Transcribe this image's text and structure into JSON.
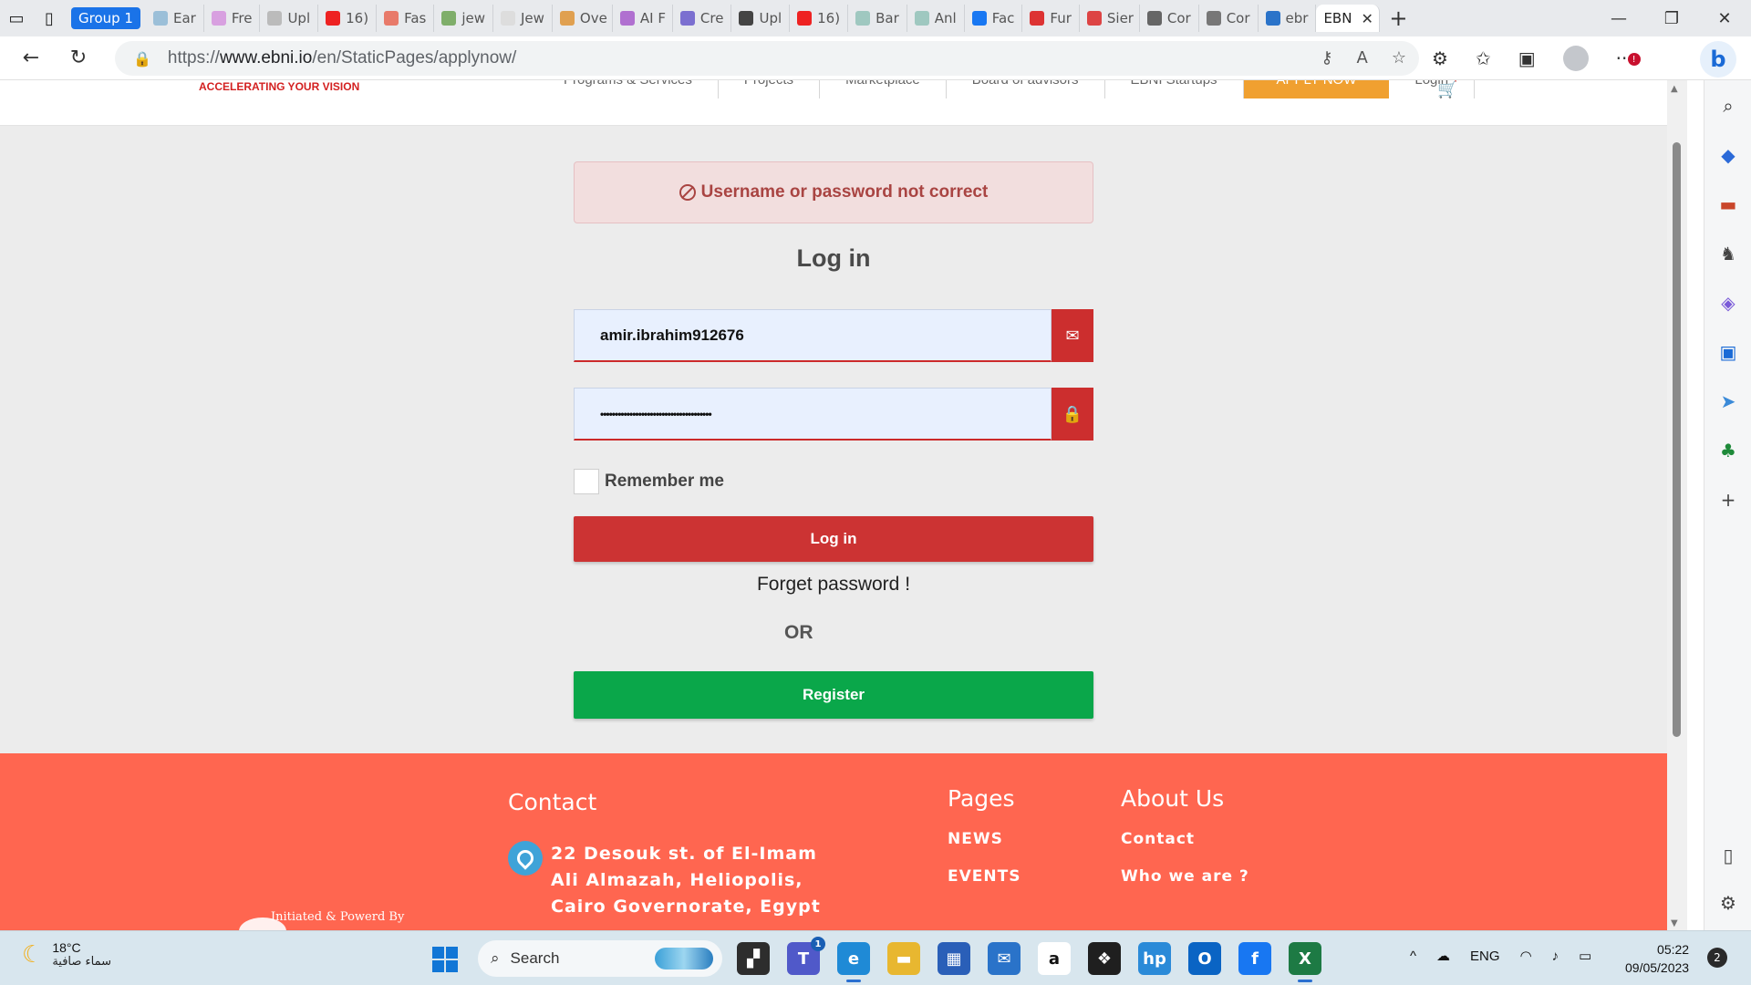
{
  "browser": {
    "group_label": "Group 1",
    "tabs": [
      "Ear",
      "Fre",
      "Upl",
      "16)",
      "Fas",
      "jew",
      "Jew",
      "Ove",
      "AI F",
      "Cre",
      "Upl",
      "16)",
      "Bar",
      "Anl",
      "Fac",
      "Fur",
      "Sier",
      "Cor",
      "Cor",
      "ebr"
    ],
    "active_tab": "EBN",
    "url_prefix": "https://",
    "url_domain": "www.ebni.io",
    "url_path": "/en/StaticPages/applynow/"
  },
  "site": {
    "tagline": "ACCELERATING YOUR VISION",
    "nav": [
      "Programs & Services",
      "Projects",
      "Marketplace",
      "Board of advisors",
      "EBNI Startups",
      "APPLY NOW",
      "Login"
    ]
  },
  "login": {
    "alert": "Username or password not correct",
    "title": "Log in",
    "username_value": "amir.ibrahim912676",
    "password_dots": "••••••••••••••••••••••••••••••••••••••",
    "remember_label": "Remember me",
    "login_button": "Log in",
    "forget_link": "Forget password !",
    "or_label": "OR",
    "register_button": "Register"
  },
  "footer": {
    "contact_title": "Contact",
    "address": "22 Desouk st. of El-Imam Ali Almazah, Heliopolis, Cairo Governorate, Egypt",
    "pages_title": "Pages",
    "pages_links": [
      "NEWS",
      "EVENTS"
    ],
    "about_title": "About Us",
    "about_links": [
      "Contact",
      "Who we are ?"
    ],
    "powered_by": "Initiated & Powerd By"
  },
  "taskbar": {
    "temperature": "18°C",
    "weather_desc": "سماء صافية",
    "search_placeholder": "Search",
    "language": "ENG",
    "time": "05:22",
    "date": "09/05/2023",
    "teams_badge": "1",
    "notification_count": "2"
  },
  "colors": {
    "brand_red": "#cc3333",
    "register_green": "#0aa74a",
    "footer_coral": "#ff6650",
    "alert_bg": "#f2dede",
    "apply_orange": "#f0a030"
  }
}
